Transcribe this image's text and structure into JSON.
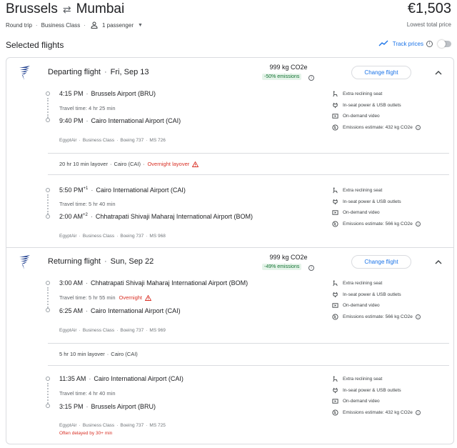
{
  "header": {
    "origin": "Brussels",
    "destination": "Mumbai",
    "swap_icon": "⇄",
    "price": "€1,503",
    "price_note": "Lowest total price",
    "trip_type": "Round trip",
    "cabin": "Business Class",
    "passengers": "1 passenger"
  },
  "section_title": "Selected flights",
  "track_prices": {
    "label": "Track prices",
    "enabled": false
  },
  "colors": {
    "accent": "#1a73e8",
    "warning": "#d93025",
    "eco_green": "#137333"
  },
  "departing": {
    "title": "Departing flight",
    "date": "Fri, Sep 13",
    "co2": "999 kg CO2e",
    "co2_badge": "-50% emissions",
    "change_label": "Change flight",
    "seg1": {
      "dep_time": "4:15 PM",
      "dep_airport": "Brussels Airport (BRU)",
      "travel_time": "Travel time: 4 hr 25 min",
      "arr_time": "9:40 PM",
      "arr_airport": "Cairo International Airport (CAI)",
      "airline": "EgyptAir",
      "cabin": "Business Class",
      "aircraft": "Boeing 737",
      "flight_no": "MS 726",
      "amenities": [
        "Extra reclining seat",
        "In-seat power & USB outlets",
        "On-demand video",
        "Emissions estimate: 432 kg CO2e"
      ]
    },
    "layover": {
      "text": "20 hr 10 min layover",
      "place": "Cairo (CAI)",
      "note": "Overnight layover"
    },
    "seg2": {
      "dep_time": "5:50 PM",
      "dep_sup": "+1",
      "dep_airport": "Cairo International Airport (CAI)",
      "travel_time": "Travel time: 5 hr 40 min",
      "arr_time": "2:00 AM",
      "arr_sup": "+2",
      "arr_airport": "Chhatrapati Shivaji Maharaj International Airport (BOM)",
      "airline": "EgyptAir",
      "cabin": "Business Class",
      "aircraft": "Boeing 737",
      "flight_no": "MS 968",
      "amenities": [
        "Extra reclining seat",
        "In-seat power & USB outlets",
        "On-demand video",
        "Emissions estimate: 566 kg CO2e"
      ]
    }
  },
  "returning": {
    "title": "Returning flight",
    "date": "Sun, Sep 22",
    "co2": "999 kg CO2e",
    "co2_badge": "-49% emissions",
    "change_label": "Change flight",
    "seg1": {
      "dep_time": "3:00 AM",
      "dep_airport": "Chhatrapati Shivaji Maharaj International Airport (BOM)",
      "travel_time": "Travel time: 5 hr 55 min",
      "travel_note": "Overnight",
      "arr_time": "6:25 AM",
      "arr_airport": "Cairo International Airport (CAI)",
      "airline": "EgyptAir",
      "cabin": "Business Class",
      "aircraft": "Boeing 737",
      "flight_no": "MS 969",
      "amenities": [
        "Extra reclining seat",
        "In-seat power & USB outlets",
        "On-demand video",
        "Emissions estimate: 566 kg CO2e"
      ]
    },
    "layover": {
      "text": "5 hr 10 min layover",
      "place": "Cairo (CAI)"
    },
    "seg2": {
      "dep_time": "11:35 AM",
      "dep_airport": "Cairo International Airport (CAI)",
      "travel_time": "Travel time: 4 hr 40 min",
      "arr_time": "3:15 PM",
      "arr_airport": "Brussels Airport (BRU)",
      "airline": "EgyptAir",
      "cabin": "Business Class",
      "aircraft": "Boeing 737",
      "flight_no": "MS 725",
      "delay_note": "Often delayed by 30+ min",
      "amenities": [
        "Extra reclining seat",
        "In-seat power & USB outlets",
        "On-demand video",
        "Emissions estimate: 432 kg CO2e"
      ]
    }
  }
}
